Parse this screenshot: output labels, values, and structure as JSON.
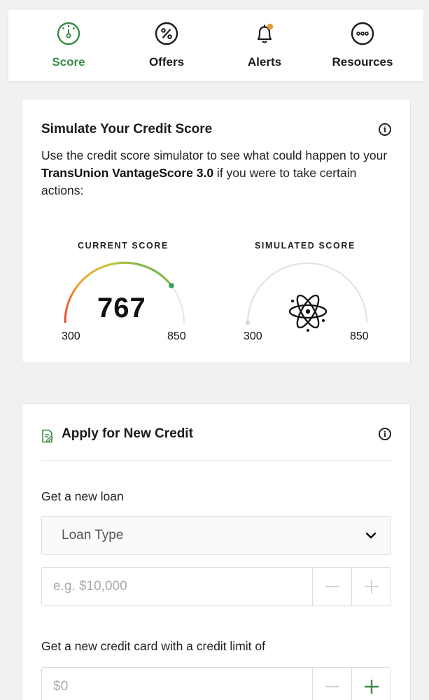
{
  "nav": {
    "items": [
      {
        "label": "Score",
        "icon": "speedometer-icon",
        "active": true
      },
      {
        "label": "Offers",
        "icon": "percent-icon",
        "active": false
      },
      {
        "label": "Alerts",
        "icon": "bell-icon",
        "active": false
      },
      {
        "label": "Resources",
        "icon": "more-dots-icon",
        "active": false
      }
    ],
    "active_color": "#3b8a47",
    "alert_dot_color": "#e69a3b"
  },
  "simulator": {
    "title": "Simulate Your Credit Score",
    "desc_prefix": "Use the credit score simulator to see what could happen to your ",
    "desc_bold": "TransUnion VantageScore 3.0",
    "desc_suffix": " if you were to take certain actions:",
    "current": {
      "label": "CURRENT SCORE",
      "score": "767",
      "min": "300",
      "max": "850"
    },
    "simulated": {
      "label": "SIMULATED SCORE",
      "min": "300",
      "max": "850"
    }
  },
  "apply": {
    "title": "Apply for New Credit",
    "loan_label": "Get a new loan",
    "loan_type_value": "Loan Type",
    "loan_amount_placeholder": "e.g. $10,000",
    "card_label": "Get a new credit card with a credit limit of",
    "card_amount_placeholder": "$0"
  }
}
